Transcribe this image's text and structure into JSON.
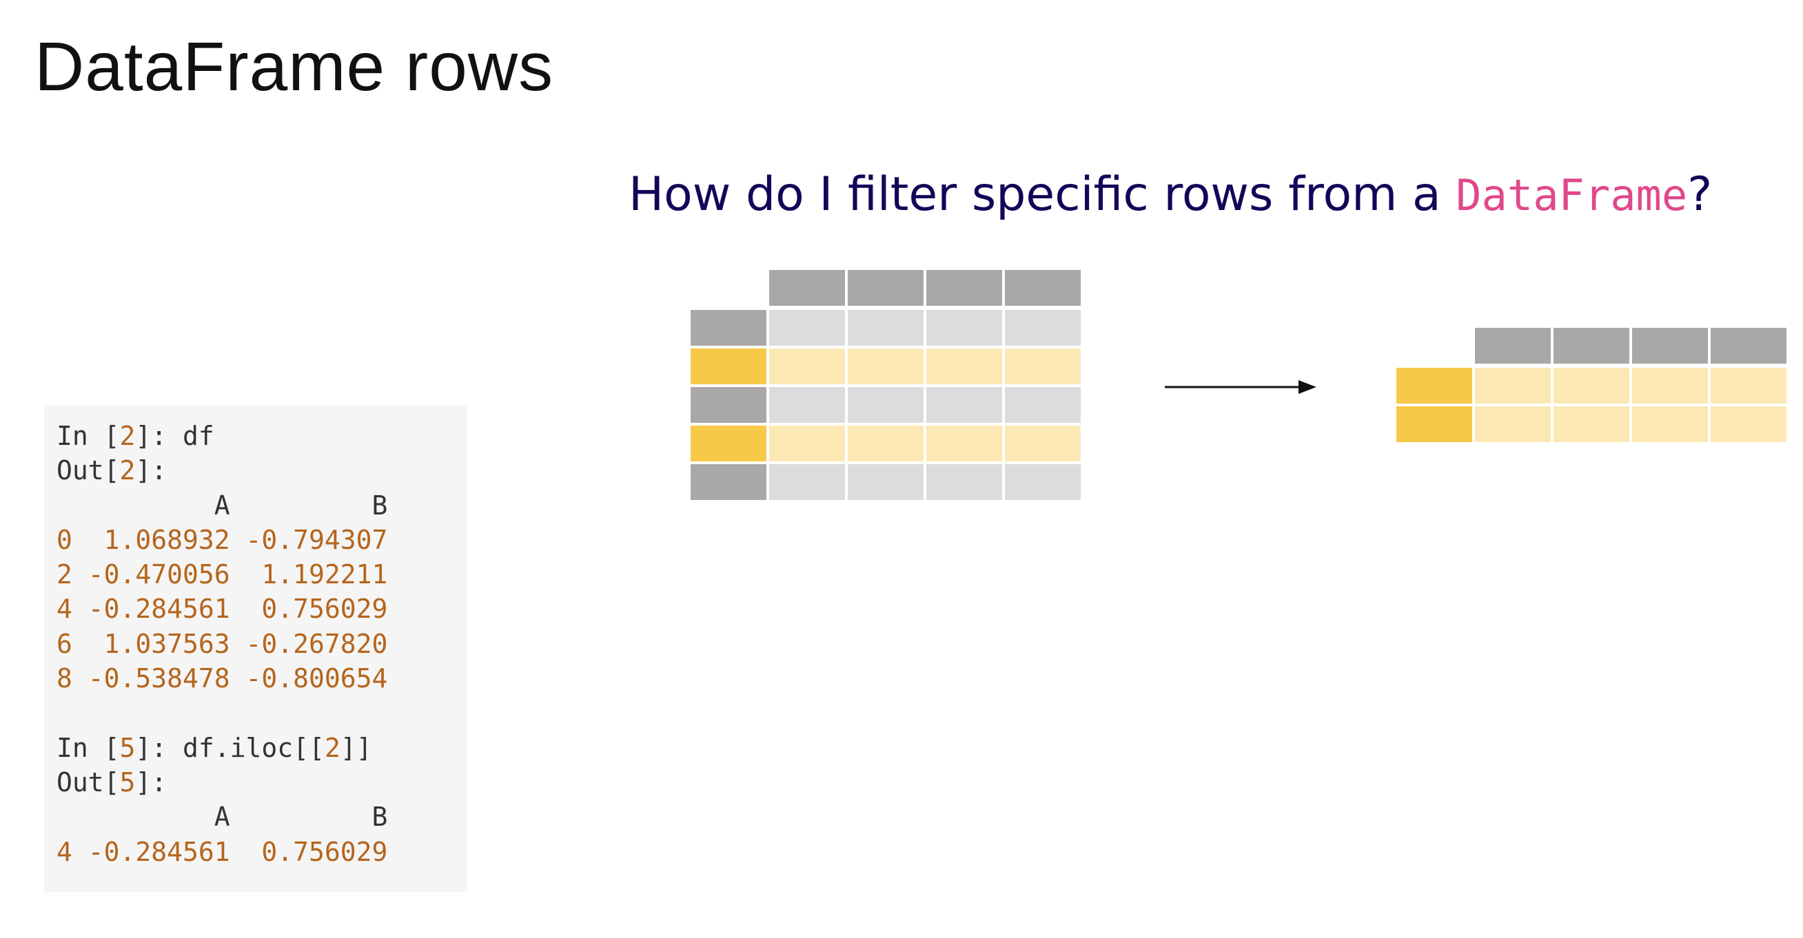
{
  "slide": {
    "title": "DataFrame rows",
    "question_prefix": "How do I filter specific rows from a ",
    "question_code": "DataFrame",
    "question_suffix": "?"
  },
  "code": {
    "lines": [
      [
        {
          "t": "In [",
          "c": ""
        },
        {
          "t": "2",
          "c": "num"
        },
        {
          "t": "]: df",
          "c": ""
        }
      ],
      [
        {
          "t": "Out[",
          "c": ""
        },
        {
          "t": "2",
          "c": "num"
        },
        {
          "t": "]:",
          "c": ""
        }
      ],
      [
        {
          "t": "          A         B",
          "c": ""
        }
      ],
      [
        {
          "t": "0  1.068932 -0.794307",
          "c": "out"
        }
      ],
      [
        {
          "t": "2 -0.470056  1.192211",
          "c": "out"
        }
      ],
      [
        {
          "t": "4 -0.284561  0.756029",
          "c": "out"
        }
      ],
      [
        {
          "t": "6  1.037563 -0.267820",
          "c": "out"
        }
      ],
      [
        {
          "t": "8 -0.538478 -0.800654",
          "c": "out"
        }
      ],
      [
        {
          "t": "",
          "c": ""
        }
      ],
      [
        {
          "t": "In [",
          "c": ""
        },
        {
          "t": "5",
          "c": "num"
        },
        {
          "t": "]: df.iloc[[",
          "c": ""
        },
        {
          "t": "2",
          "c": "num"
        },
        {
          "t": "]]",
          "c": ""
        }
      ],
      [
        {
          "t": "Out[",
          "c": ""
        },
        {
          "t": "5",
          "c": "num"
        },
        {
          "t": "]:",
          "c": ""
        }
      ],
      [
        {
          "t": "          A         B",
          "c": ""
        }
      ],
      [
        {
          "t": "4 -0.284561  0.756029",
          "c": "out"
        }
      ]
    ]
  },
  "diagram": {
    "colors": {
      "header": "#a9a8a7",
      "cell": "#dcdcdc",
      "selected_index": "#f7c948",
      "selected_cell": "#fbe8b5",
      "arrow": "#111111"
    },
    "source": {
      "columns": 4,
      "rows": [
        "unselected",
        "selected",
        "unselected",
        "selected",
        "unselected"
      ]
    },
    "result": {
      "columns": 4,
      "rows": [
        "selected",
        "selected"
      ]
    }
  }
}
